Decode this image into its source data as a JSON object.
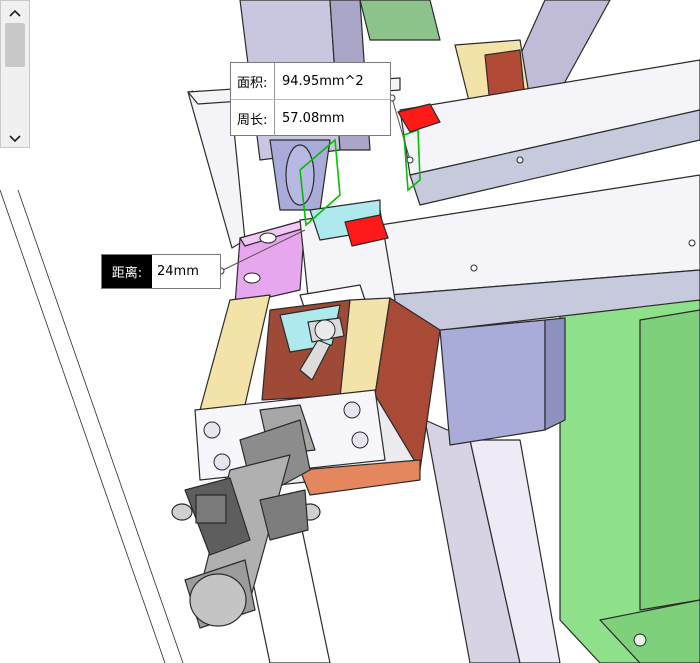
{
  "scrollbar": {
    "up_icon": "chevron-up-icon",
    "down_icon": "chevron-down-icon"
  },
  "measurements": {
    "area_label": "面积:",
    "area_value": "94.95mm^2",
    "perimeter_label": "周长:",
    "perimeter_value": "57.08mm",
    "distance_label": "距离:",
    "distance_value": "24mm"
  },
  "colors": {
    "cad_edge": "#2b2b2b",
    "base_green": "#8fe08a",
    "beige": "#f3e3a8",
    "brown": "#a84a36",
    "pink": "#e7a7ee",
    "cyan": "#aee9ee",
    "red_marker": "#ff0000",
    "selection_green": "#00c000"
  }
}
